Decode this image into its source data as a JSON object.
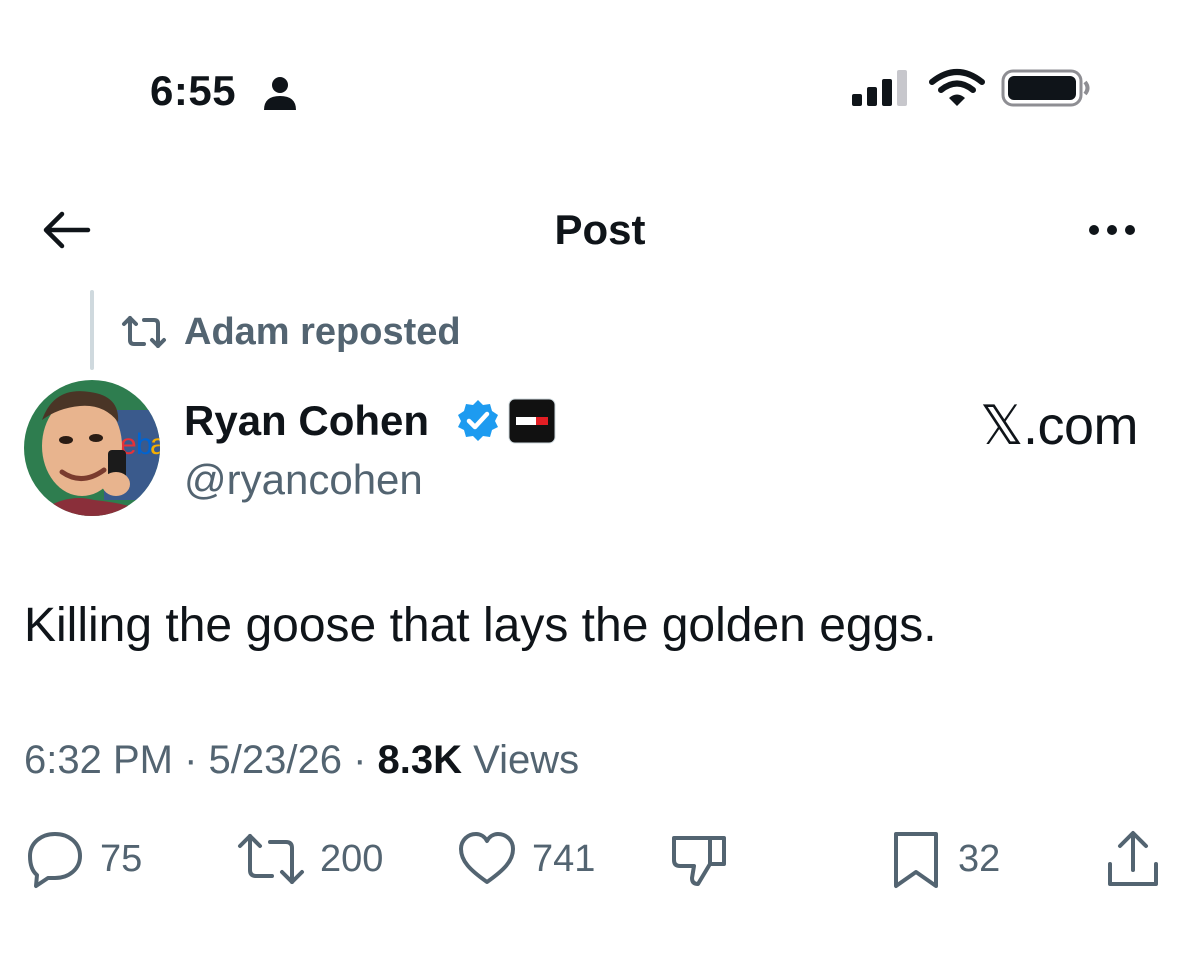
{
  "status_bar": {
    "time": "6:55",
    "person_icon": "person-icon",
    "signal_icon": "cellular-signal-icon",
    "wifi_icon": "wifi-icon",
    "battery_icon": "battery-icon"
  },
  "header": {
    "title": "Post",
    "back_icon": "arrow-left-icon",
    "more_icon": "more-horizontal-icon"
  },
  "repost": {
    "label": "Adam reposted",
    "icon": "repost-icon"
  },
  "author": {
    "name": "Ryan Cohen",
    "handle": "@ryancohen",
    "verified_icon": "verified-badge-icon",
    "affiliate_badge": "gamestop-affiliate-badge"
  },
  "watermark": "𝕏.com",
  "post": {
    "text": "Killing the goose that lays the golden eggs."
  },
  "meta": {
    "time": "6:32 PM",
    "separator1": " · ",
    "date": "5/23/26",
    "separator2": " · ",
    "views_count": "8.3K",
    "views_label": " Views"
  },
  "actions": {
    "replies": "75",
    "reposts": "200",
    "likes": "741",
    "bookmarks": "32"
  },
  "colors": {
    "text_primary": "#0f1419",
    "text_secondary": "#536471",
    "verified_blue": "#1d9bf0",
    "divider": "#cfd9de"
  }
}
